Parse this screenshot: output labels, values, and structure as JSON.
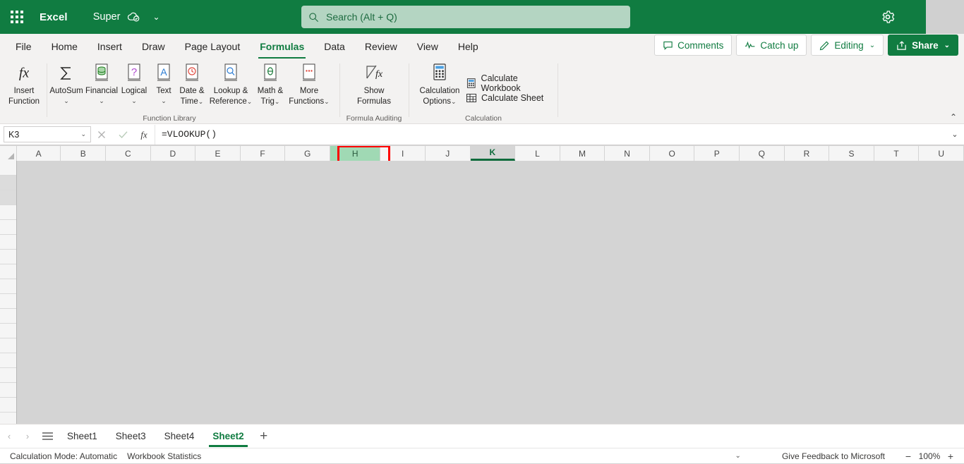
{
  "titlebar": {
    "app_name": "Excel",
    "doc_name": "Super",
    "waffle_icon": "app-launcher-icon",
    "cloud_icon": "cloud-saved-icon",
    "doc_chevron": "⌄",
    "gear_icon": "settings-gear-icon",
    "brand_color": "#107c41"
  },
  "search": {
    "placeholder": "Search (Alt + Q)",
    "icon": "search-icon"
  },
  "ribbon_tabs": [
    {
      "label": "File",
      "active": false
    },
    {
      "label": "Home",
      "active": false
    },
    {
      "label": "Insert",
      "active": false
    },
    {
      "label": "Draw",
      "active": false
    },
    {
      "label": "Page Layout",
      "active": false
    },
    {
      "label": "Formulas",
      "active": true
    },
    {
      "label": "Data",
      "active": false
    },
    {
      "label": "Review",
      "active": false
    },
    {
      "label": "View",
      "active": false
    },
    {
      "label": "Help",
      "active": false
    }
  ],
  "tab_actions": {
    "comments": "Comments",
    "catch_up": "Catch up",
    "editing": "Editing",
    "share": "Share",
    "chevron": "⌄"
  },
  "ribbon": {
    "collapse_chevron": "⌃",
    "groups": [
      {
        "name": "Function Library",
        "label": "Function Library"
      },
      {
        "name": "Formula Auditing",
        "label": "Formula Auditing"
      },
      {
        "name": "Calculation",
        "label": "Calculation"
      }
    ],
    "insert_function": {
      "line1": "Insert",
      "line2": "Function"
    },
    "autosum": {
      "line1": "AutoSum",
      "chev": "⌄"
    },
    "financial": {
      "line1": "Financial",
      "chev": "⌄"
    },
    "logical": {
      "line1": "Logical",
      "chev": "⌄"
    },
    "text": {
      "line1": "Text",
      "chev": "⌄"
    },
    "date_time": {
      "line1": "Date &",
      "line2": "Time",
      "chev": "⌄"
    },
    "lookup_reference": {
      "line1": "Lookup &",
      "line2": "Reference",
      "chev": "⌄"
    },
    "math_trig": {
      "line1": "Math &",
      "line2": "Trig",
      "chev": "⌄"
    },
    "more_functions": {
      "line1": "More",
      "line2": "Functions",
      "chev": "⌄"
    },
    "show_formulas": {
      "line1": "Show",
      "line2": "Formulas"
    },
    "calculation_options": {
      "line1": "Calculation",
      "line2": "Options",
      "chev": "⌄"
    },
    "calculate_workbook": "Calculate Workbook",
    "calculate_sheet": "Calculate Sheet"
  },
  "formula_bar": {
    "name_box_value": "K3",
    "name_box_chevron": "⌄",
    "cancel_icon": "cancel-x-icon",
    "enter_icon": "confirm-check-icon",
    "insert_function_icon": "fx-icon",
    "formula_value": "=VLOOKUP()",
    "expand_chevron": "⌄"
  },
  "grid": {
    "columns": [
      "A",
      "B",
      "C",
      "D",
      "E",
      "F",
      "G",
      "H",
      "I",
      "J",
      "K",
      "L",
      "M",
      "N",
      "O",
      "P",
      "Q",
      "R",
      "S",
      "T",
      "U"
    ],
    "highlighted_column": "H",
    "highlighted_color": "#a0d9b4",
    "annotation_color": "#ff0000",
    "active_column": "K",
    "active_cell": "K3",
    "row_count": 18
  },
  "sheet_tabs": {
    "prev_arrow": "‹",
    "next_arrow": "›",
    "all_sheets_icon": "all-sheets-menu-icon",
    "tabs": [
      {
        "label": "Sheet1",
        "active": false
      },
      {
        "label": "Sheet3",
        "active": false
      },
      {
        "label": "Sheet4",
        "active": false
      },
      {
        "label": "Sheet2",
        "active": true
      }
    ],
    "add_label": "+"
  },
  "status_bar": {
    "calculation_mode": "Calculation Mode: Automatic",
    "workbook_statistics": "Workbook Statistics",
    "chevron": "⌄",
    "feedback": "Give Feedback to Microsoft",
    "zoom_out": "−",
    "zoom_level": "100%",
    "zoom_in": "+"
  }
}
